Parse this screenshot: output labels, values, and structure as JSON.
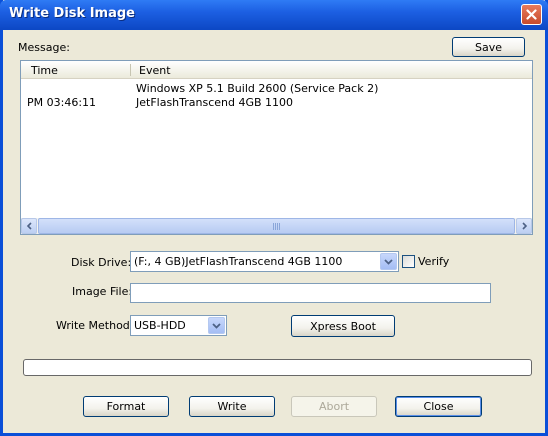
{
  "window": {
    "title": "Write Disk Image"
  },
  "message": {
    "label": "Message:",
    "save_label": "Save",
    "columns": [
      "Time",
      "Event"
    ],
    "rows": [
      {
        "time": "",
        "event": "Windows XP 5.1 Build 2600 (Service Pack 2)"
      },
      {
        "time": "PM 03:46:11",
        "event": "JetFlashTranscend 4GB   1100"
      }
    ]
  },
  "form": {
    "disk_drive_label": "Disk Drive:",
    "disk_drive_value": "(F:, 4 GB)JetFlashTranscend 4GB   1100",
    "verify_label": "Verify",
    "verify_checked": false,
    "image_file_label": "Image File:",
    "image_file_value": "",
    "write_method_label": "Write Method:",
    "write_method_value": "USB-HDD",
    "xpress_boot_label": "Xpress Boot"
  },
  "progress": {
    "value": 0
  },
  "buttons": {
    "format": "Format",
    "write": "Write",
    "abort": "Abort",
    "close": "Close"
  },
  "colors": {
    "title_bar": "#0c47c4",
    "face": "#ece9d8",
    "border": "#7f9db9"
  }
}
